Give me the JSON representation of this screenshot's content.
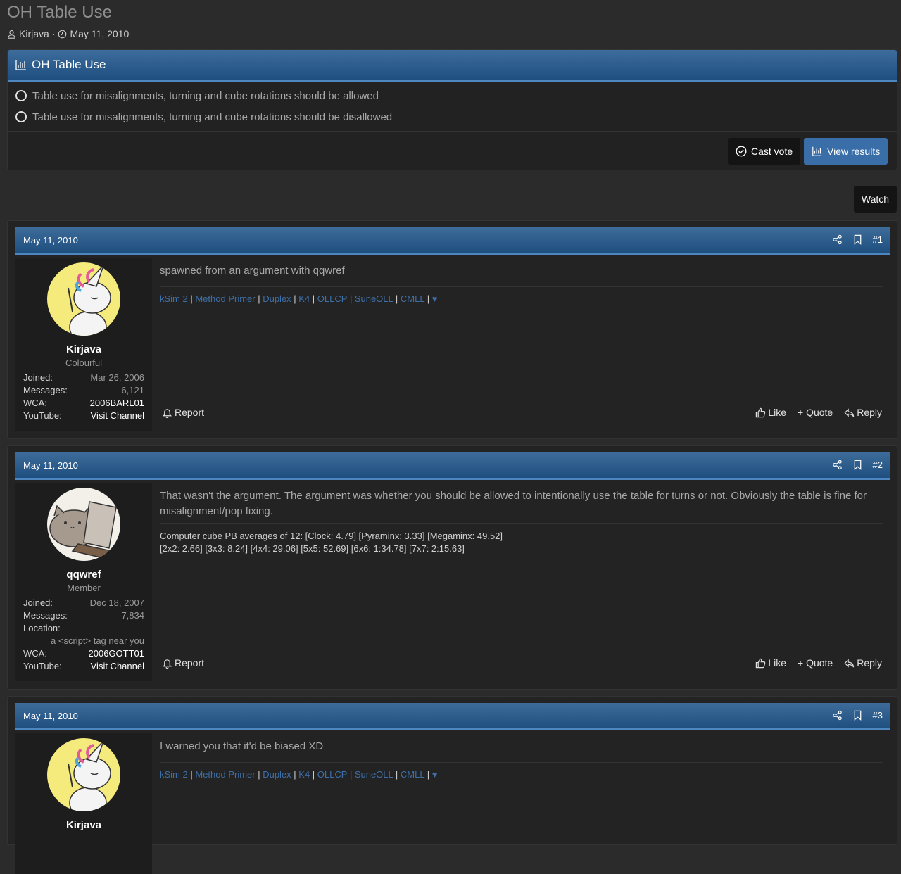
{
  "thread": {
    "title": "OH Table Use",
    "author": "Kirjava",
    "date": "May 11, 2010"
  },
  "poll": {
    "title": "OH Table Use",
    "options": [
      "Table use for misalignments, turning and cube rotations should be allowed",
      "Table use for misalignments, turning and cube rotations should be disallowed"
    ],
    "cast_vote": "Cast vote",
    "view_results": "View results"
  },
  "watch_label": "Watch",
  "labels": {
    "joined": "Joined:",
    "messages": "Messages:",
    "wca": "WCA:",
    "youtube": "YouTube:",
    "location": "Location:",
    "report": "Report",
    "like": "Like",
    "quote": "+ Quote",
    "reply": "Reply"
  },
  "posts": [
    {
      "date": "May 11, 2010",
      "number": "#1",
      "user": {
        "name": "Kirjava",
        "title": "Colourful",
        "joined": "Mar 26, 2006",
        "messages": "6,121",
        "wca": "2006BARL01",
        "youtube": "Visit Channel"
      },
      "message": "spawned from an argument with qqwref"
    },
    {
      "date": "May 11, 2010",
      "number": "#2",
      "user": {
        "name": "qqwref",
        "title": "Member",
        "joined": "Dec 18, 2007",
        "messages": "7,834",
        "location": "a <script> tag near you",
        "wca": "2006GOTT01",
        "youtube": "Visit Channel"
      },
      "message": "That wasn't the argument. The argument was whether you should be allowed to intentionally use the table for turns or not. Obviously the table is fine for misalignment/pop fixing.",
      "signature_lines": [
        "Computer cube PB averages of 12: [Clock: 4.79] [Pyraminx: 3.33] [Megaminx: 49.52]",
        "[2x2: 2.66] [3x3: 8.24] [4x4: 29.06] [5x5: 52.69] [6x6: 1:34.78] [7x7: 2:15.63]"
      ]
    },
    {
      "date": "May 11, 2010",
      "number": "#3",
      "user": {
        "name": "Kirjava"
      },
      "message": "I warned you that it'd be biased XD"
    }
  ],
  "kirjava_signature_links": [
    "kSim 2",
    "Method Primer",
    "Duplex",
    "K4",
    "OLLCP",
    "SuneOLL",
    "CMLL",
    "♥"
  ],
  "colors": {
    "background": "#2b2b2b",
    "header_blue": "#1f4f7f",
    "accent_blue": "#3a6ea8",
    "link_blue": "#3d6fa8"
  }
}
